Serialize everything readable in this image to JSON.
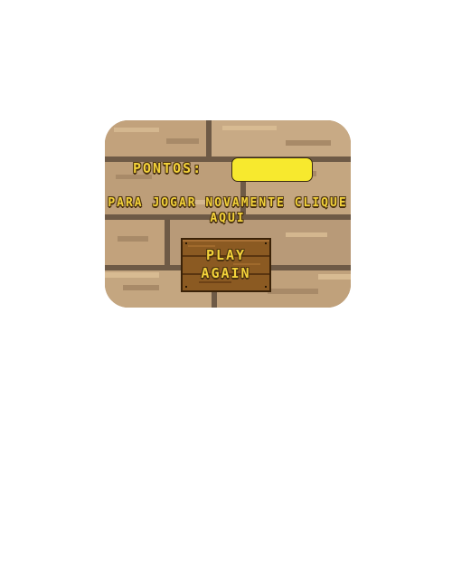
{
  "game": {
    "score_label": "Pontos:",
    "score_value": "",
    "instruction_text": "Para Jogar novamente clique aqui",
    "play_again_label": "PLAY AGAIN"
  },
  "colors": {
    "brick_light": "#c8aa85",
    "brick_mid": "#b89a78",
    "mortar": "#6e5a46",
    "text_yellow": "#f3d23a",
    "score_box": "#f7e92e",
    "wood_light": "#8b5a22",
    "wood_dark": "#5a3510"
  }
}
